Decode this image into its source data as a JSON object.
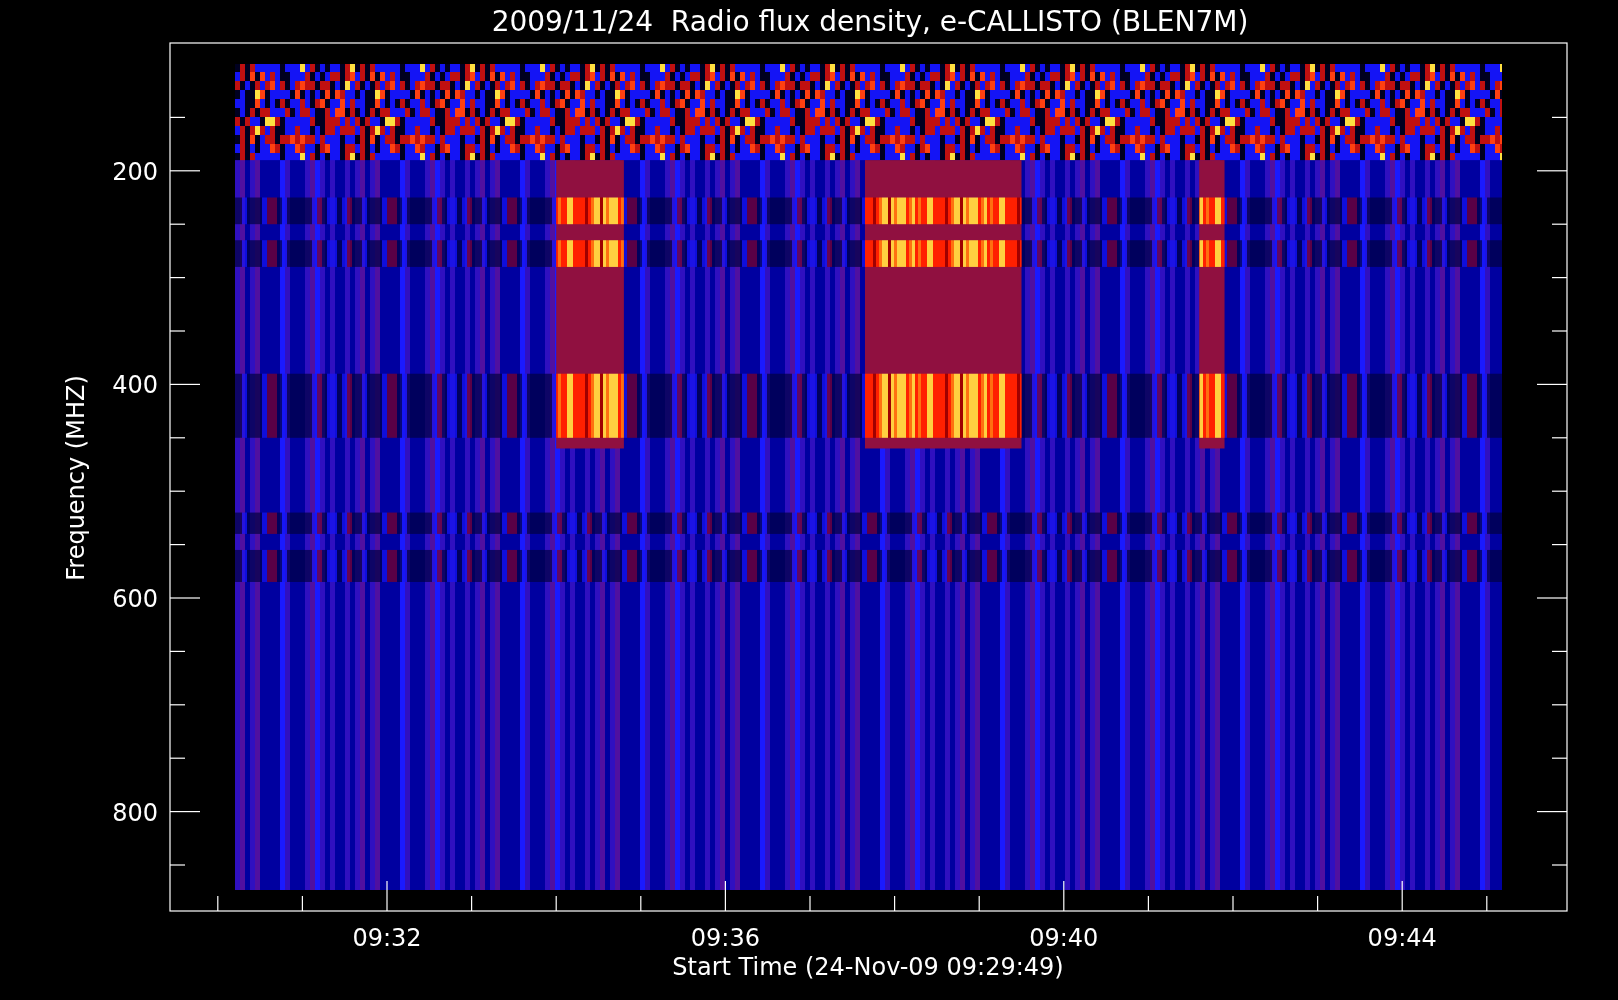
{
  "title": "2009/11/24  Radio flux density, e-CALLISTO (BLEN7M)",
  "y_axis": {
    "label": "Frequency (MHZ)",
    "ticks": [
      "200",
      "400",
      "600",
      "800"
    ]
  },
  "x_axis": {
    "label": "Start Time (24-Nov-09 09:29:49)",
    "ticks": [
      "09:32",
      "09:36",
      "09:40",
      "09:44"
    ]
  }
}
